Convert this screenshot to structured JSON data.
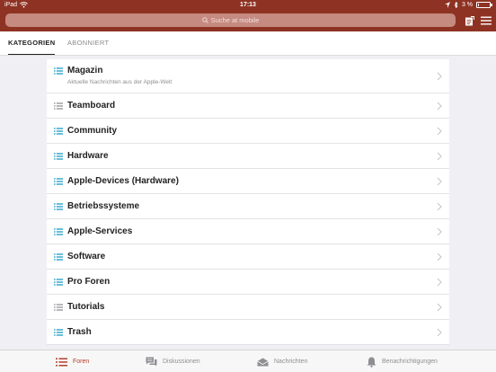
{
  "status_bar": {
    "carrier": "iPad",
    "time": "17:13",
    "battery_text": "3 %",
    "battery_level": 0.03
  },
  "search": {
    "placeholder": "Suche at mobile",
    "icon": "search-icon"
  },
  "header_buttons": [
    {
      "name": "new-post-button",
      "icon": "compose-icon"
    },
    {
      "name": "menu-button",
      "icon": "hamburger-icon"
    }
  ],
  "tabs": [
    {
      "label": "KATEGORIEN",
      "active": true
    },
    {
      "label": "ABONNIERT",
      "active": false
    }
  ],
  "categories": [
    {
      "title": "Magazin",
      "subtitle": "Aktuelle Nachrichten aus der Apple-Welt",
      "highlighted": true
    },
    {
      "title": "Teamboard",
      "highlighted": false
    },
    {
      "title": "Community",
      "highlighted": true
    },
    {
      "title": "Hardware",
      "highlighted": true
    },
    {
      "title": "Apple-Devices (Hardware)",
      "highlighted": true
    },
    {
      "title": "Betriebssysteme",
      "highlighted": true
    },
    {
      "title": "Apple-Services",
      "highlighted": true
    },
    {
      "title": "Software",
      "highlighted": true
    },
    {
      "title": "Pro Foren",
      "highlighted": true
    },
    {
      "title": "Tutorials",
      "highlighted": false
    },
    {
      "title": "Trash",
      "highlighted": true
    }
  ],
  "bottom_tabs": [
    {
      "label": "Foren",
      "icon": "list-icon",
      "active": true
    },
    {
      "label": "Diskussionen",
      "icon": "chat-bubbles-icon",
      "active": false
    },
    {
      "label": "Nachrichten",
      "icon": "envelope-icon",
      "active": false
    },
    {
      "label": "Benachrichtigungen",
      "icon": "bell-icon",
      "active": false
    }
  ],
  "colors": {
    "header": "#8e3324",
    "accent": "#b23f2c",
    "list_icon_active": "#2ea3c9",
    "list_icon_inactive": "#9a9a9e"
  }
}
